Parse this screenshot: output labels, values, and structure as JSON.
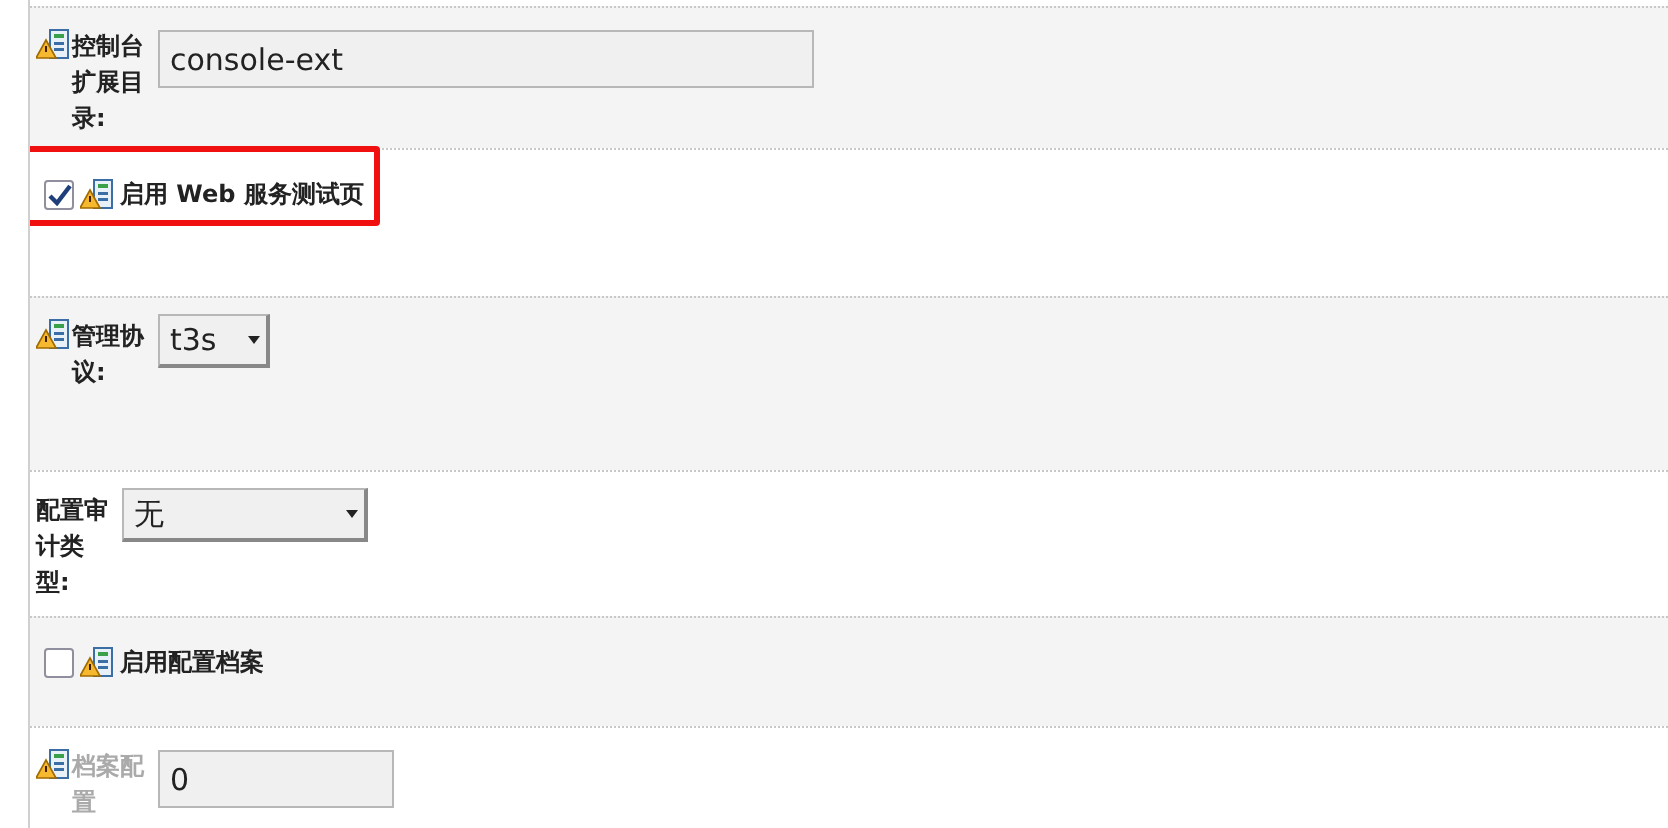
{
  "rows": [
    {
      "kind": "text",
      "label": "控制台扩展目录:",
      "has_icon": true,
      "value": "console-ext",
      "disabled": false,
      "highlighted": false
    },
    {
      "kind": "checkbox",
      "label": "启用 Web 服务测试页",
      "has_icon": true,
      "checked": true,
      "highlighted": true
    },
    {
      "kind": "select",
      "label": "管理协议:",
      "has_icon": true,
      "value": "t3s",
      "disabled": false,
      "highlighted": false
    },
    {
      "kind": "select",
      "label": "配置审计类型:",
      "has_icon": false,
      "value": "无",
      "disabled": false,
      "highlighted": false
    },
    {
      "kind": "checkbox",
      "label": "启用配置档案",
      "has_icon": true,
      "checked": false,
      "highlighted": false
    },
    {
      "kind": "text",
      "label": "档案配置",
      "has_icon": true,
      "value": "0",
      "disabled": true,
      "highlighted": false
    }
  ]
}
